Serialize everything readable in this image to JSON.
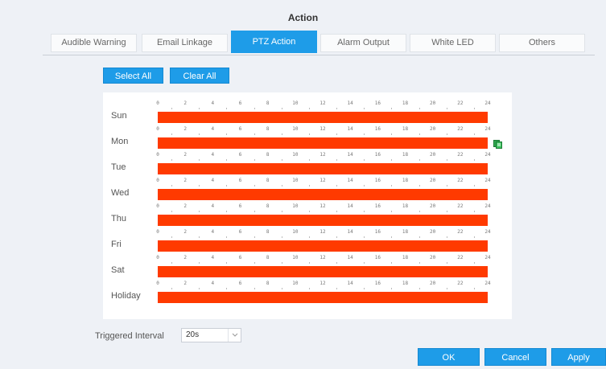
{
  "header": {
    "title": "Action"
  },
  "tabs": [
    {
      "label": "Audible Warning"
    },
    {
      "label": "Email Linkage"
    },
    {
      "label": "PTZ Action"
    },
    {
      "label": "Alarm Output"
    },
    {
      "label": "White LED"
    },
    {
      "label": "Others"
    }
  ],
  "active_tab": "PTZ Action",
  "toolbar": {
    "select_all": "Select All",
    "clear_all": "Clear All"
  },
  "schedule": {
    "hour_ticks": [
      "0",
      "2",
      "4",
      "6",
      "8",
      "10",
      "12",
      "14",
      "16",
      "18",
      "20",
      "22",
      "24"
    ],
    "days": [
      {
        "label": "Sun",
        "selected_hours": [
          0,
          24
        ]
      },
      {
        "label": "Mon",
        "selected_hours": [
          0,
          24
        ]
      },
      {
        "label": "Tue",
        "selected_hours": [
          0,
          24
        ]
      },
      {
        "label": "Wed",
        "selected_hours": [
          0,
          24
        ]
      },
      {
        "label": "Thu",
        "selected_hours": [
          0,
          24
        ]
      },
      {
        "label": "Fri",
        "selected_hours": [
          0,
          24
        ]
      },
      {
        "label": "Sat",
        "selected_hours": [
          0,
          24
        ]
      },
      {
        "label": "Holiday",
        "selected_hours": [
          0,
          24
        ]
      }
    ],
    "bar_color": "#ff3a00",
    "copy_icon_row": "Mon"
  },
  "interval": {
    "label": "Triggered Interval",
    "value": "20s"
  },
  "footer": {
    "ok": "OK",
    "cancel": "Cancel",
    "apply": "Apply"
  },
  "colors": {
    "accent": "#1e9ce8",
    "background": "#eef1f6"
  }
}
